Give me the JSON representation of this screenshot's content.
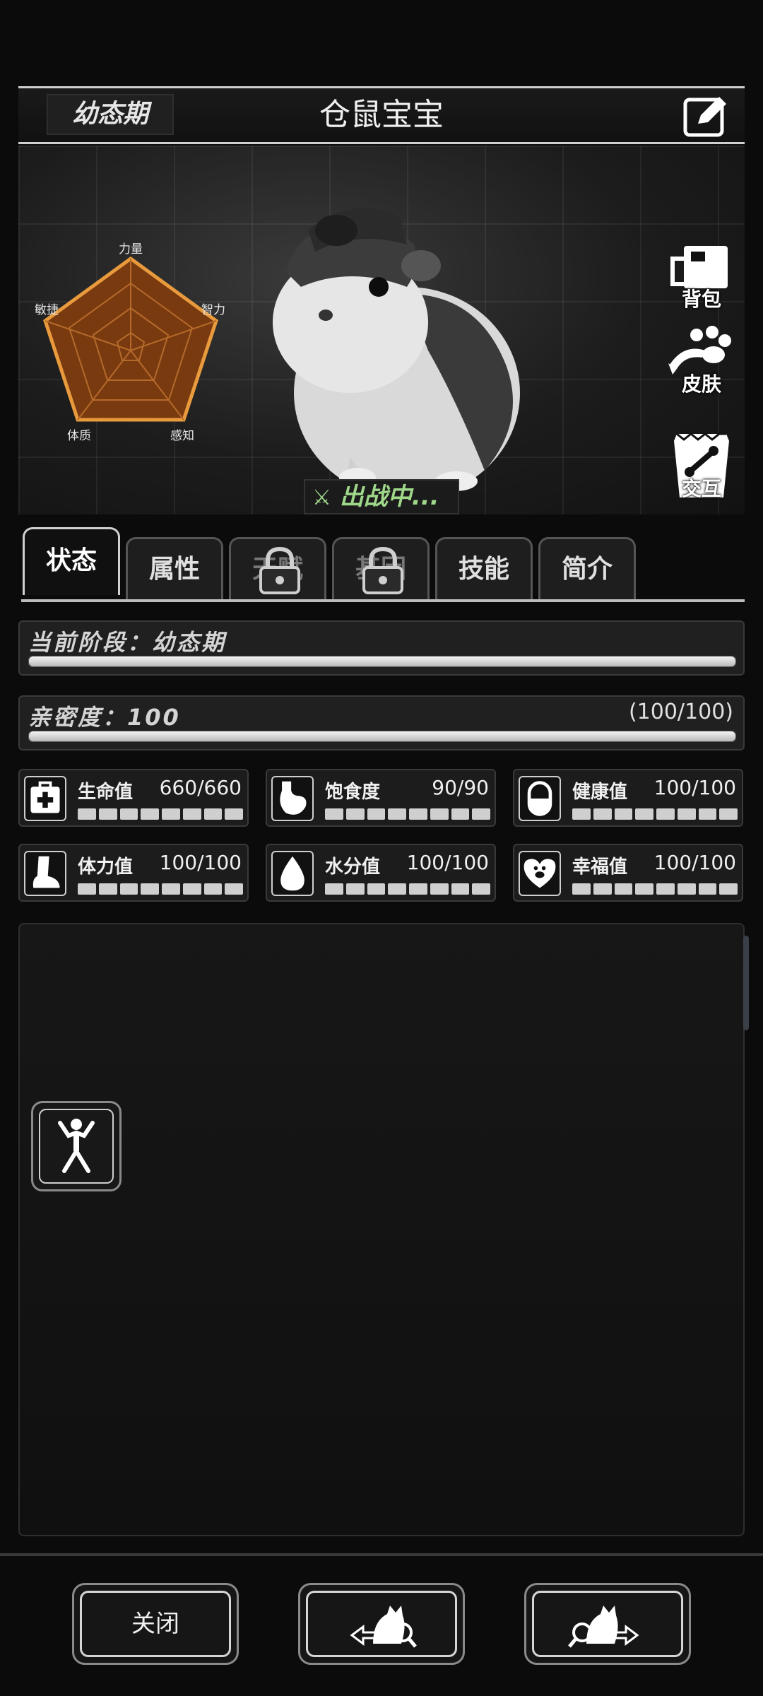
{
  "header": {
    "stage_badge": "幼态期",
    "pet_name": "仓鼠宝宝",
    "edit_icon": "edit-icon"
  },
  "radar": {
    "labels": [
      "力量",
      "智力",
      "感知",
      "体质",
      "敏捷"
    ]
  },
  "side_buttons": [
    {
      "label": "背包",
      "icon": "backpack-icon"
    },
    {
      "label": "皮肤",
      "icon": "paw-skin-icon"
    },
    {
      "label": "交互",
      "icon": "food-bag-icon"
    }
  ],
  "battle_status": "出战中...",
  "tabs": [
    {
      "label": "状态",
      "active": true,
      "locked": false
    },
    {
      "label": "属性",
      "active": false,
      "locked": false
    },
    {
      "label": "天赋",
      "active": false,
      "locked": true
    },
    {
      "label": "基因",
      "active": false,
      "locked": true
    },
    {
      "label": "技能",
      "active": false,
      "locked": false
    },
    {
      "label": "简介",
      "active": false,
      "locked": false
    }
  ],
  "stage_bar": {
    "title": "当前阶段：幼态期",
    "progress": 1.0
  },
  "intimacy_bar": {
    "title": "亲密度：100",
    "value_text": "(100/100)",
    "progress": 1.0
  },
  "stats": [
    {
      "name": "生命值",
      "value": "660/660",
      "icon": "medkit-icon"
    },
    {
      "name": "饱食度",
      "value": "90/90",
      "icon": "stomach-icon"
    },
    {
      "name": "健康值",
      "value": "100/100",
      "icon": "pill-icon"
    },
    {
      "name": "体力值",
      "value": "100/100",
      "icon": "foot-icon"
    },
    {
      "name": "水分值",
      "value": "100/100",
      "icon": "water-drop-icon"
    },
    {
      "name": "幸福值",
      "value": "100/100",
      "icon": "heart-paw-icon"
    }
  ],
  "panel": {
    "pose_icon": "pose-figure-icon"
  },
  "footer": {
    "close_label": "关闭",
    "prev_icon": "prev-pet-icon",
    "next_icon": "next-pet-icon"
  }
}
